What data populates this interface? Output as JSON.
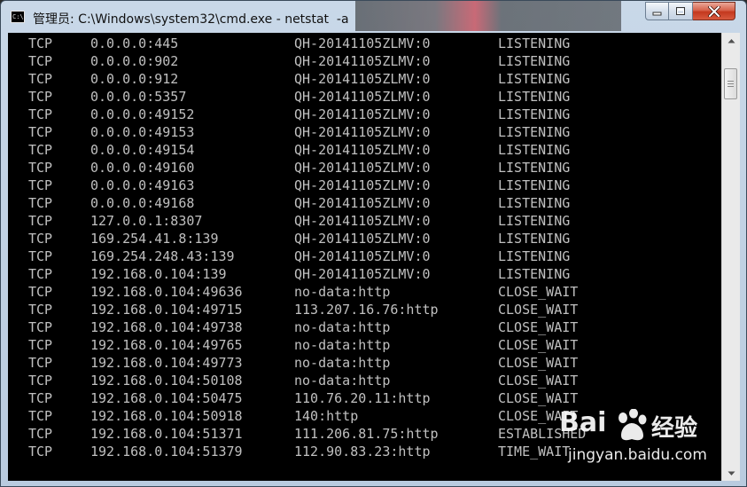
{
  "window": {
    "title": "管理员: C:\\Windows\\system32\\cmd.exe - netstat  -a",
    "icon": "cmd-icon"
  },
  "caption_buttons": {
    "minimize_icon": "minimize-icon",
    "maximize_icon": "maximize-icon",
    "close_icon": "close-icon"
  },
  "console": {
    "text_color": "#c0c0c0",
    "background": "#000000",
    "rows": [
      {
        "proto": "TCP",
        "local": "0.0.0.0:445",
        "foreign": "QH-20141105ZLMV:0",
        "state": "LISTENING"
      },
      {
        "proto": "TCP",
        "local": "0.0.0.0:902",
        "foreign": "QH-20141105ZLMV:0",
        "state": "LISTENING"
      },
      {
        "proto": "TCP",
        "local": "0.0.0.0:912",
        "foreign": "QH-20141105ZLMV:0",
        "state": "LISTENING"
      },
      {
        "proto": "TCP",
        "local": "0.0.0.0:5357",
        "foreign": "QH-20141105ZLMV:0",
        "state": "LISTENING"
      },
      {
        "proto": "TCP",
        "local": "0.0.0.0:49152",
        "foreign": "QH-20141105ZLMV:0",
        "state": "LISTENING"
      },
      {
        "proto": "TCP",
        "local": "0.0.0.0:49153",
        "foreign": "QH-20141105ZLMV:0",
        "state": "LISTENING"
      },
      {
        "proto": "TCP",
        "local": "0.0.0.0:49154",
        "foreign": "QH-20141105ZLMV:0",
        "state": "LISTENING"
      },
      {
        "proto": "TCP",
        "local": "0.0.0.0:49160",
        "foreign": "QH-20141105ZLMV:0",
        "state": "LISTENING"
      },
      {
        "proto": "TCP",
        "local": "0.0.0.0:49163",
        "foreign": "QH-20141105ZLMV:0",
        "state": "LISTENING"
      },
      {
        "proto": "TCP",
        "local": "0.0.0.0:49168",
        "foreign": "QH-20141105ZLMV:0",
        "state": "LISTENING"
      },
      {
        "proto": "TCP",
        "local": "127.0.0.1:8307",
        "foreign": "QH-20141105ZLMV:0",
        "state": "LISTENING"
      },
      {
        "proto": "TCP",
        "local": "169.254.41.8:139",
        "foreign": "QH-20141105ZLMV:0",
        "state": "LISTENING"
      },
      {
        "proto": "TCP",
        "local": "169.254.248.43:139",
        "foreign": "QH-20141105ZLMV:0",
        "state": "LISTENING"
      },
      {
        "proto": "TCP",
        "local": "192.168.0.104:139",
        "foreign": "QH-20141105ZLMV:0",
        "state": "LISTENING"
      },
      {
        "proto": "TCP",
        "local": "192.168.0.104:49636",
        "foreign": "no-data:http",
        "state": "CLOSE_WAIT"
      },
      {
        "proto": "TCP",
        "local": "192.168.0.104:49715",
        "foreign": "113.207.16.76:http",
        "state": "CLOSE_WAIT"
      },
      {
        "proto": "TCP",
        "local": "192.168.0.104:49738",
        "foreign": "no-data:http",
        "state": "CLOSE_WAIT"
      },
      {
        "proto": "TCP",
        "local": "192.168.0.104:49765",
        "foreign": "no-data:http",
        "state": "CLOSE_WAIT"
      },
      {
        "proto": "TCP",
        "local": "192.168.0.104:49773",
        "foreign": "no-data:http",
        "state": "CLOSE_WAIT"
      },
      {
        "proto": "TCP",
        "local": "192.168.0.104:50108",
        "foreign": "no-data:http",
        "state": "CLOSE_WAIT"
      },
      {
        "proto": "TCP",
        "local": "192.168.0.104:50475",
        "foreign": "110.76.20.11:http",
        "state": "CLOSE_WAIT"
      },
      {
        "proto": "TCP",
        "local": "192.168.0.104:50918",
        "foreign": "140:http",
        "state": "CLOSE_WAIT"
      },
      {
        "proto": "TCP",
        "local": "192.168.0.104:51371",
        "foreign": "111.206.81.75:http",
        "state": "ESTABLISHED"
      },
      {
        "proto": "TCP",
        "local": "192.168.0.104:51379",
        "foreign": "112.90.83.23:http",
        "state": "TIME_WAIT"
      }
    ]
  },
  "scrollbar": {
    "up_icon": "scroll-up-arrow-icon",
    "down_icon": "scroll-down-arrow-icon"
  },
  "watermark": {
    "brand_left": "Bai",
    "brand_right": "经验",
    "url": "jingyan.baidu.com",
    "icon": "baidu-paw-icon"
  }
}
